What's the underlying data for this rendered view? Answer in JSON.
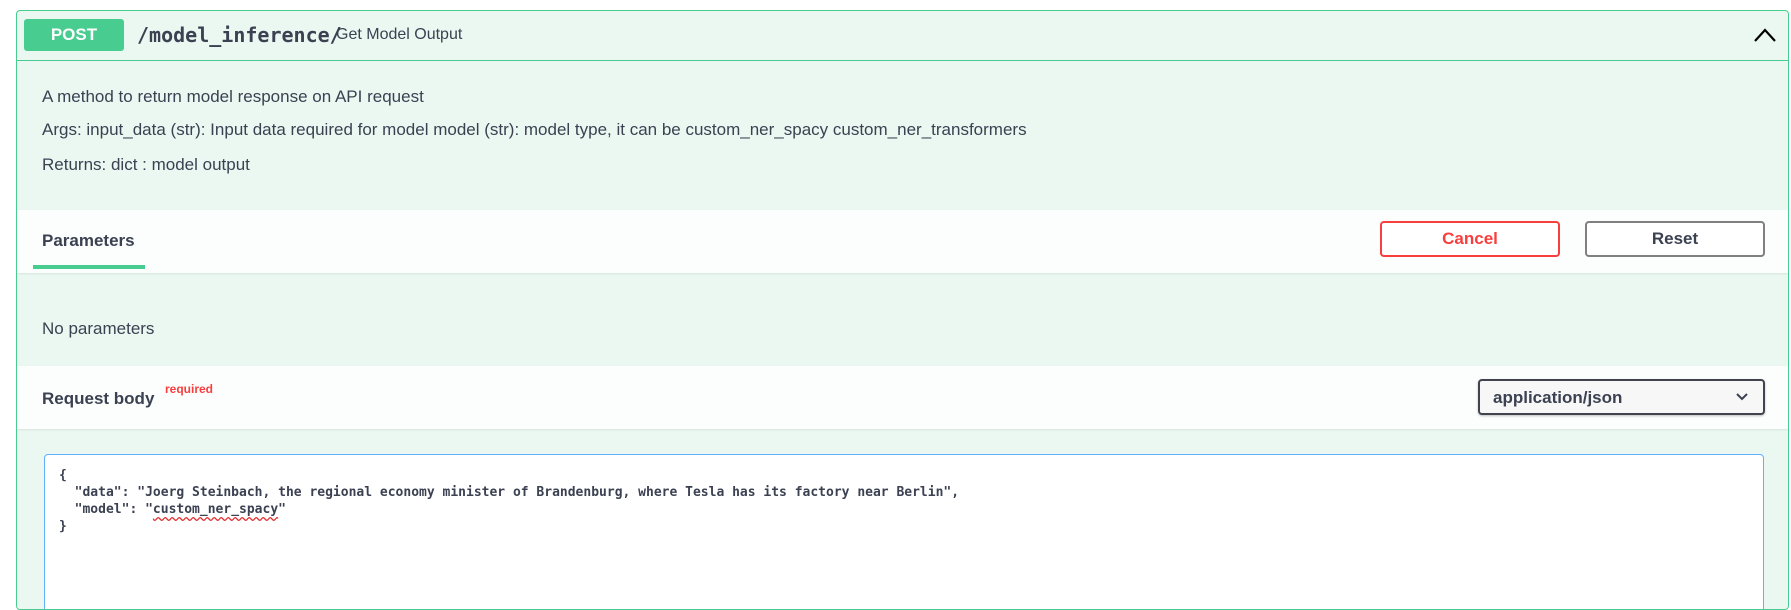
{
  "operation": {
    "method": "POST",
    "path": "/model_inference/",
    "summary": "Get Model Output",
    "description": {
      "line1": "A method to return model response on API request",
      "line2": "Args: input_data (str): Input data required for model model (str): model type, it can be custom_ner_spacy custom_ner_transformers",
      "line3": "Returns: dict : model output"
    }
  },
  "parameters": {
    "tab_label": "Parameters",
    "cancel_label": "Cancel",
    "reset_label": "Reset",
    "empty_text": "No parameters"
  },
  "request_body": {
    "title": "Request body",
    "required_label": "required",
    "content_type": "application/json",
    "editor": {
      "open": "{",
      "data_line": "  \"data\": \"Joerg Steinbach, the regional economy minister of Brandenburg, where Tesla has its factory near Berlin\",",
      "model_prefix": "  \"model\": \"",
      "model_value": "custom_ner_spacy",
      "model_suffix": "\"",
      "close": "}"
    }
  },
  "colors": {
    "post_green": "#49cc90",
    "cancel_red": "#f93e3e",
    "editor_border": "#61affe"
  },
  "icons": {
    "collapse": "chevron-up-icon",
    "select": "chevron-down-icon"
  }
}
